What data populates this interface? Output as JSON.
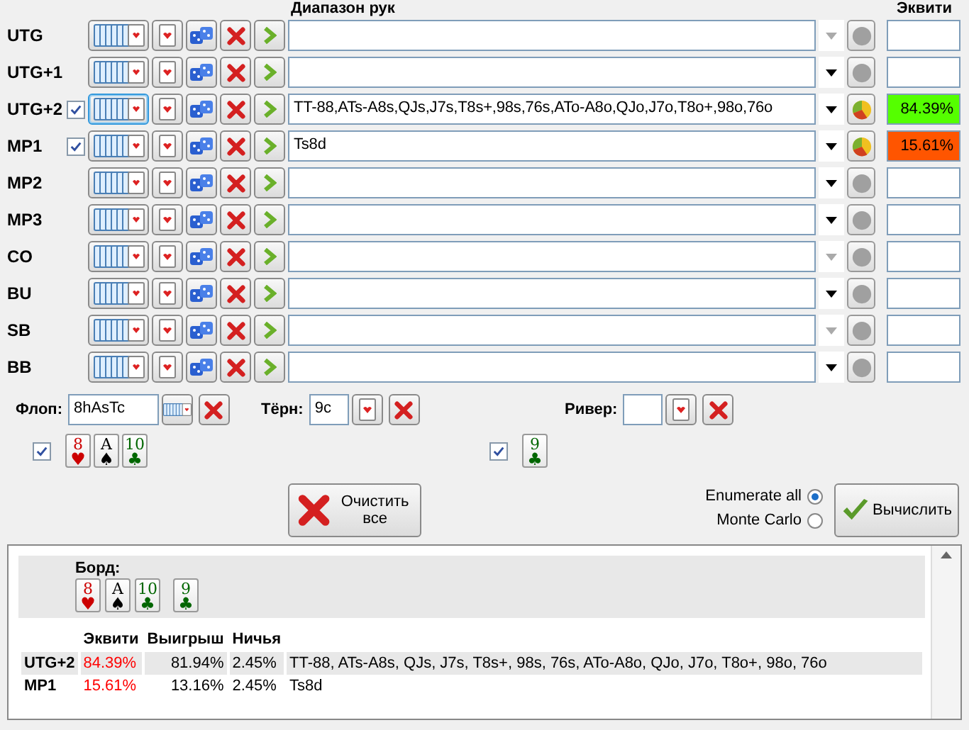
{
  "headers": {
    "range": "Диапазон рук",
    "equity": "Эквити"
  },
  "players": [
    {
      "name": "UTG",
      "checked": false,
      "focused": false,
      "dropdown_enabled": false,
      "has_result": false
    },
    {
      "name": "UTG+1",
      "checked": false,
      "focused": false,
      "dropdown_enabled": true,
      "has_result": false
    },
    {
      "name": "UTG+2",
      "checked": true,
      "focused": true,
      "range": "TT-88,ATs-A8s,QJs,J7s,T8s+,98s,76s,ATo-A8o,QJo,J7o,T8o+,98o,76o",
      "dropdown_enabled": true,
      "has_result": true,
      "equity": "84.39%",
      "color": "#55ff00"
    },
    {
      "name": "MP1",
      "checked": true,
      "focused": false,
      "range": "Ts8d",
      "dropdown_enabled": true,
      "has_result": true,
      "equity": "15.61%",
      "color": "#ff5500"
    },
    {
      "name": "MP2",
      "checked": false,
      "focused": false,
      "dropdown_enabled": true,
      "has_result": false
    },
    {
      "name": "MP3",
      "checked": false,
      "focused": false,
      "dropdown_enabled": true,
      "has_result": false
    },
    {
      "name": "CO",
      "checked": false,
      "focused": false,
      "dropdown_enabled": false,
      "has_result": false
    },
    {
      "name": "BU",
      "checked": false,
      "focused": false,
      "dropdown_enabled": true,
      "has_result": false
    },
    {
      "name": "SB",
      "checked": false,
      "focused": false,
      "dropdown_enabled": false,
      "has_result": false
    },
    {
      "name": "BB",
      "checked": false,
      "focused": false,
      "dropdown_enabled": true,
      "has_result": false
    }
  ],
  "board": [
    {
      "kind": "flop",
      "label": "Флоп:",
      "value": "8hAsTc",
      "checked": true,
      "cards": [
        {
          "rank": "8",
          "suit": "♥",
          "color": "#cc0000"
        },
        {
          "rank": "A",
          "suit": "♠",
          "color": "#000000"
        },
        {
          "rank": "10",
          "suit": "♣",
          "color": "#006600"
        }
      ]
    },
    {
      "kind": "turn",
      "label": "Тёрн:",
      "value": "9c",
      "checked": true,
      "cards": [
        {
          "rank": "9",
          "suit": "♣",
          "color": "#006600"
        }
      ]
    },
    {
      "kind": "river",
      "label": "Ривер:",
      "checked": false
    }
  ],
  "clear_button": "Очистить все",
  "modes": [
    {
      "label": "Enumerate all",
      "selected": true
    },
    {
      "label": "Monte Carlo",
      "selected": false
    }
  ],
  "compute_button": "Вычислить",
  "results": {
    "board_label": "Борд:",
    "board_cards": [
      {
        "rank": "8",
        "suit": "♥",
        "color": "#cc0000"
      },
      {
        "rank": "A",
        "suit": "♠",
        "color": "#000000"
      },
      {
        "rank": "10",
        "suit": "♣",
        "color": "#006600"
      },
      {
        "rank": "9",
        "suit": "♣",
        "color": "#006600"
      }
    ],
    "columns": [
      "Эквити",
      "Выигрыш",
      "Ничья"
    ],
    "rows": [
      {
        "player": "UTG+2",
        "equity": "84.39%",
        "win": "81.94%",
        "tie": "2.45%",
        "range": "TT-88, ATs-A8s, QJs, J7s, T8s+, 98s, 76s, ATo-A8o, QJo, J7o, T8o+, 98o, 76o"
      },
      {
        "player": "MP1",
        "equity": "15.61%",
        "win": "13.16%",
        "tie": "2.45%",
        "range": "Ts8d"
      }
    ]
  }
}
